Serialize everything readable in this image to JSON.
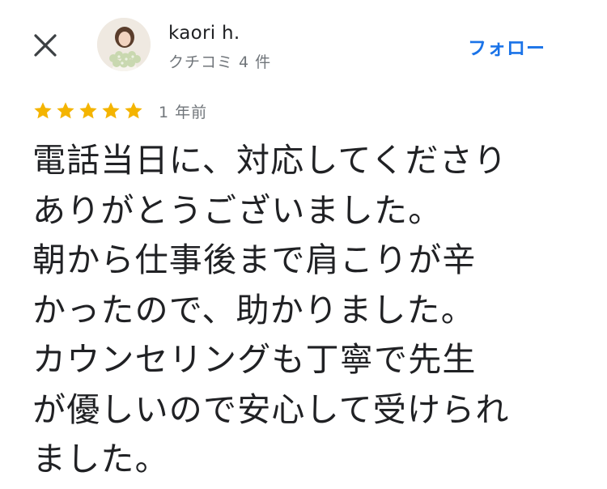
{
  "header": {
    "close_icon": "close-icon",
    "author": {
      "name": "kaori h.",
      "meta": "クチコミ 4 件",
      "avatar_icon": "avatar-photo"
    },
    "follow_label": "フォロー"
  },
  "review": {
    "rating": 5,
    "max_rating": 5,
    "star_color": "#f4b400",
    "date": "1 年前",
    "text": "電話当日に、対応してくださり\nありがとうございました。\n朝から仕事後まで肩こりが辛\nかったので、助かりました。\nカウンセリングも丁寧で先生\nが優しいので安心して受けられ\nました。"
  },
  "colors": {
    "accent": "#1a73e8",
    "text_primary": "#202124",
    "text_secondary": "#70757a",
    "star": "#f4b400"
  }
}
